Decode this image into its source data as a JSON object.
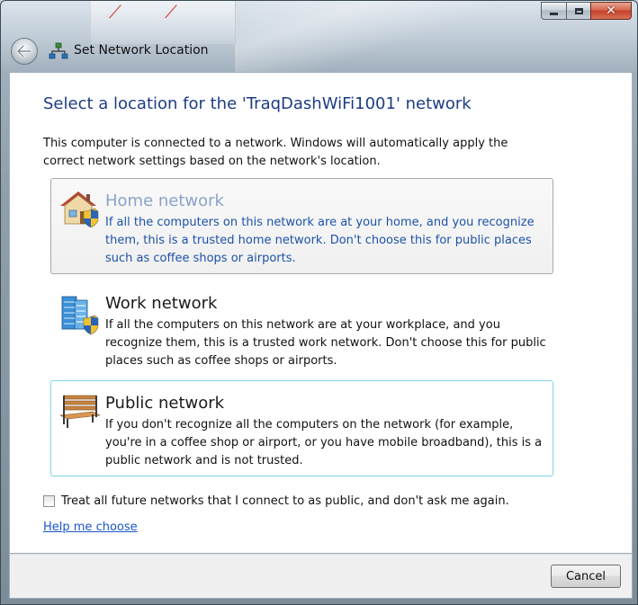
{
  "window": {
    "title": "Set Network Location",
    "caption_buttons": {
      "minimize": "minimize-icon",
      "maximize": "maximize-icon",
      "close": "close-icon"
    }
  },
  "page": {
    "heading": "Select a location for the 'TraqDashWiFi1001' network",
    "intro": "This computer is connected to a network. Windows will automatically apply the correct network settings based on the network's location."
  },
  "options": [
    {
      "id": "home",
      "icon": "home-network-icon",
      "title": "Home network",
      "description": "If all the computers on this network are at your home, and you recognize them, this is a trusted home network.  Don't choose this for public places such as coffee shops or airports."
    },
    {
      "id": "work",
      "icon": "work-network-icon",
      "title": "Work network",
      "description": "If all the computers on this network are at your workplace, and you recognize them, this is a trusted work network.  Don't choose this for public places such as coffee shops or airports."
    },
    {
      "id": "public",
      "icon": "public-network-icon",
      "title": "Public network",
      "description": "If you don't recognize all the computers on the network (for example, you're in a coffee shop or airport, or you have mobile broadband), this is a public network and is not trusted."
    }
  ],
  "treat_public": {
    "label": "Treat all future networks that I connect to as public, and don't ask me again.",
    "checked": false
  },
  "help_link": "Help me choose",
  "buttons": {
    "cancel": "Cancel"
  },
  "colors": {
    "heading": "#1e3c84",
    "link": "#1a55c8",
    "home_desc": "#1d52a8"
  }
}
